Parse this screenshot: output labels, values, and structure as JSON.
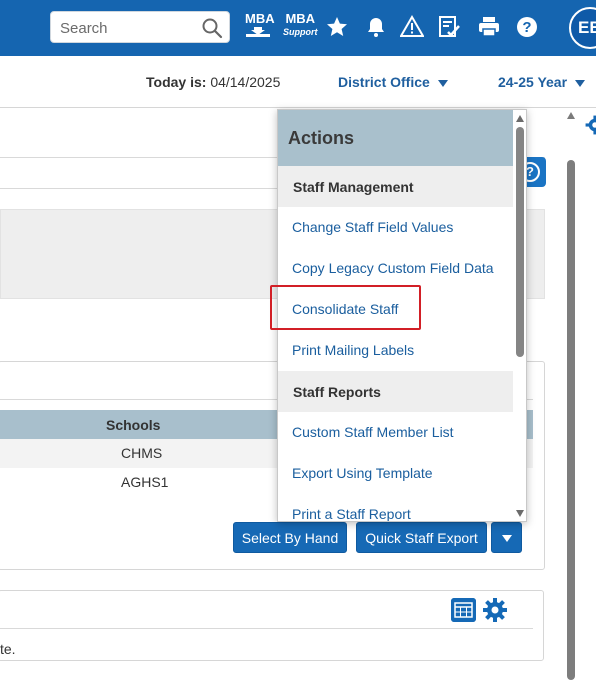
{
  "topbar": {
    "search_placeholder": "Search",
    "mba_label": "MBA",
    "mba_support_label": "MBA",
    "mba_support_sub": "Support",
    "avatar_initials": "EE",
    "icons": [
      "search-icon",
      "mba-download-icon",
      "mba-support-icon",
      "star-icon",
      "bell-icon",
      "warning-icon",
      "checklist-icon",
      "printer-icon",
      "help-icon"
    ]
  },
  "infobar": {
    "today_label": "Today is:",
    "today_value": "04/14/2025",
    "office": "District Office",
    "year": "24-25 Year"
  },
  "table": {
    "column": "Schools",
    "rows": [
      "CHMS",
      "AGHS1"
    ]
  },
  "buttons": {
    "select_by_hand": "Select By Hand",
    "quick_staff_export": "Quick Staff Export"
  },
  "footer_text": "te.",
  "actions": {
    "title": "Actions",
    "sections": [
      {
        "heading": "Staff Management",
        "items": [
          "Change Staff Field Values",
          "Copy Legacy Custom Field Data",
          "Consolidate Staff",
          "Print Mailing Labels"
        ]
      },
      {
        "heading": "Staff Reports",
        "items": [
          "Custom Staff Member List",
          "Export Using Template",
          "Print a Staff Report"
        ]
      }
    ]
  },
  "colors": {
    "brand_blue": "#1565b0",
    "link_blue": "#1a5e9e",
    "header_slate": "#a9c0cc",
    "highlight_red": "#d21f26"
  }
}
